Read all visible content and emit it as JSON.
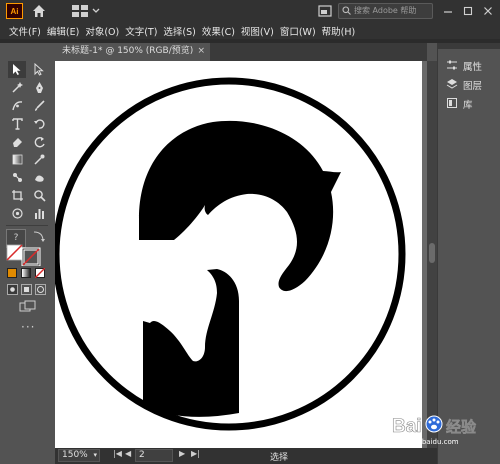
{
  "app": {
    "logo_text": "Ai"
  },
  "titlebar": {
    "search_placeholder": "搜索 Adobe 帮助"
  },
  "menu": [
    {
      "label": "文件(F)"
    },
    {
      "label": "编辑(E)"
    },
    {
      "label": "对象(O)"
    },
    {
      "label": "文字(T)"
    },
    {
      "label": "选择(S)"
    },
    {
      "label": "效果(C)"
    },
    {
      "label": "视图(V)"
    },
    {
      "label": "窗口(W)"
    },
    {
      "label": "帮助(H)"
    }
  ],
  "document": {
    "tab_title": "未标题-1* @ 150% (RGB/预览)",
    "close_glyph": "×"
  },
  "right_panel": [
    {
      "label": "属性",
      "icon": "properties-icon"
    },
    {
      "label": "图层",
      "icon": "layers-icon"
    },
    {
      "label": "库",
      "icon": "libraries-icon"
    }
  ],
  "status": {
    "zoom": "150%",
    "artboard": "2",
    "tool_text": "选择"
  },
  "watermark": {
    "text": "Bai 经验",
    "sub": "jingyan.baidu.com"
  },
  "colors": {
    "accent_orange": "#ff9a00",
    "bg": "#535353",
    "bar": "#323232",
    "fill_swatch": "#e08a00",
    "stroke_swatch": "#d92b2b"
  }
}
